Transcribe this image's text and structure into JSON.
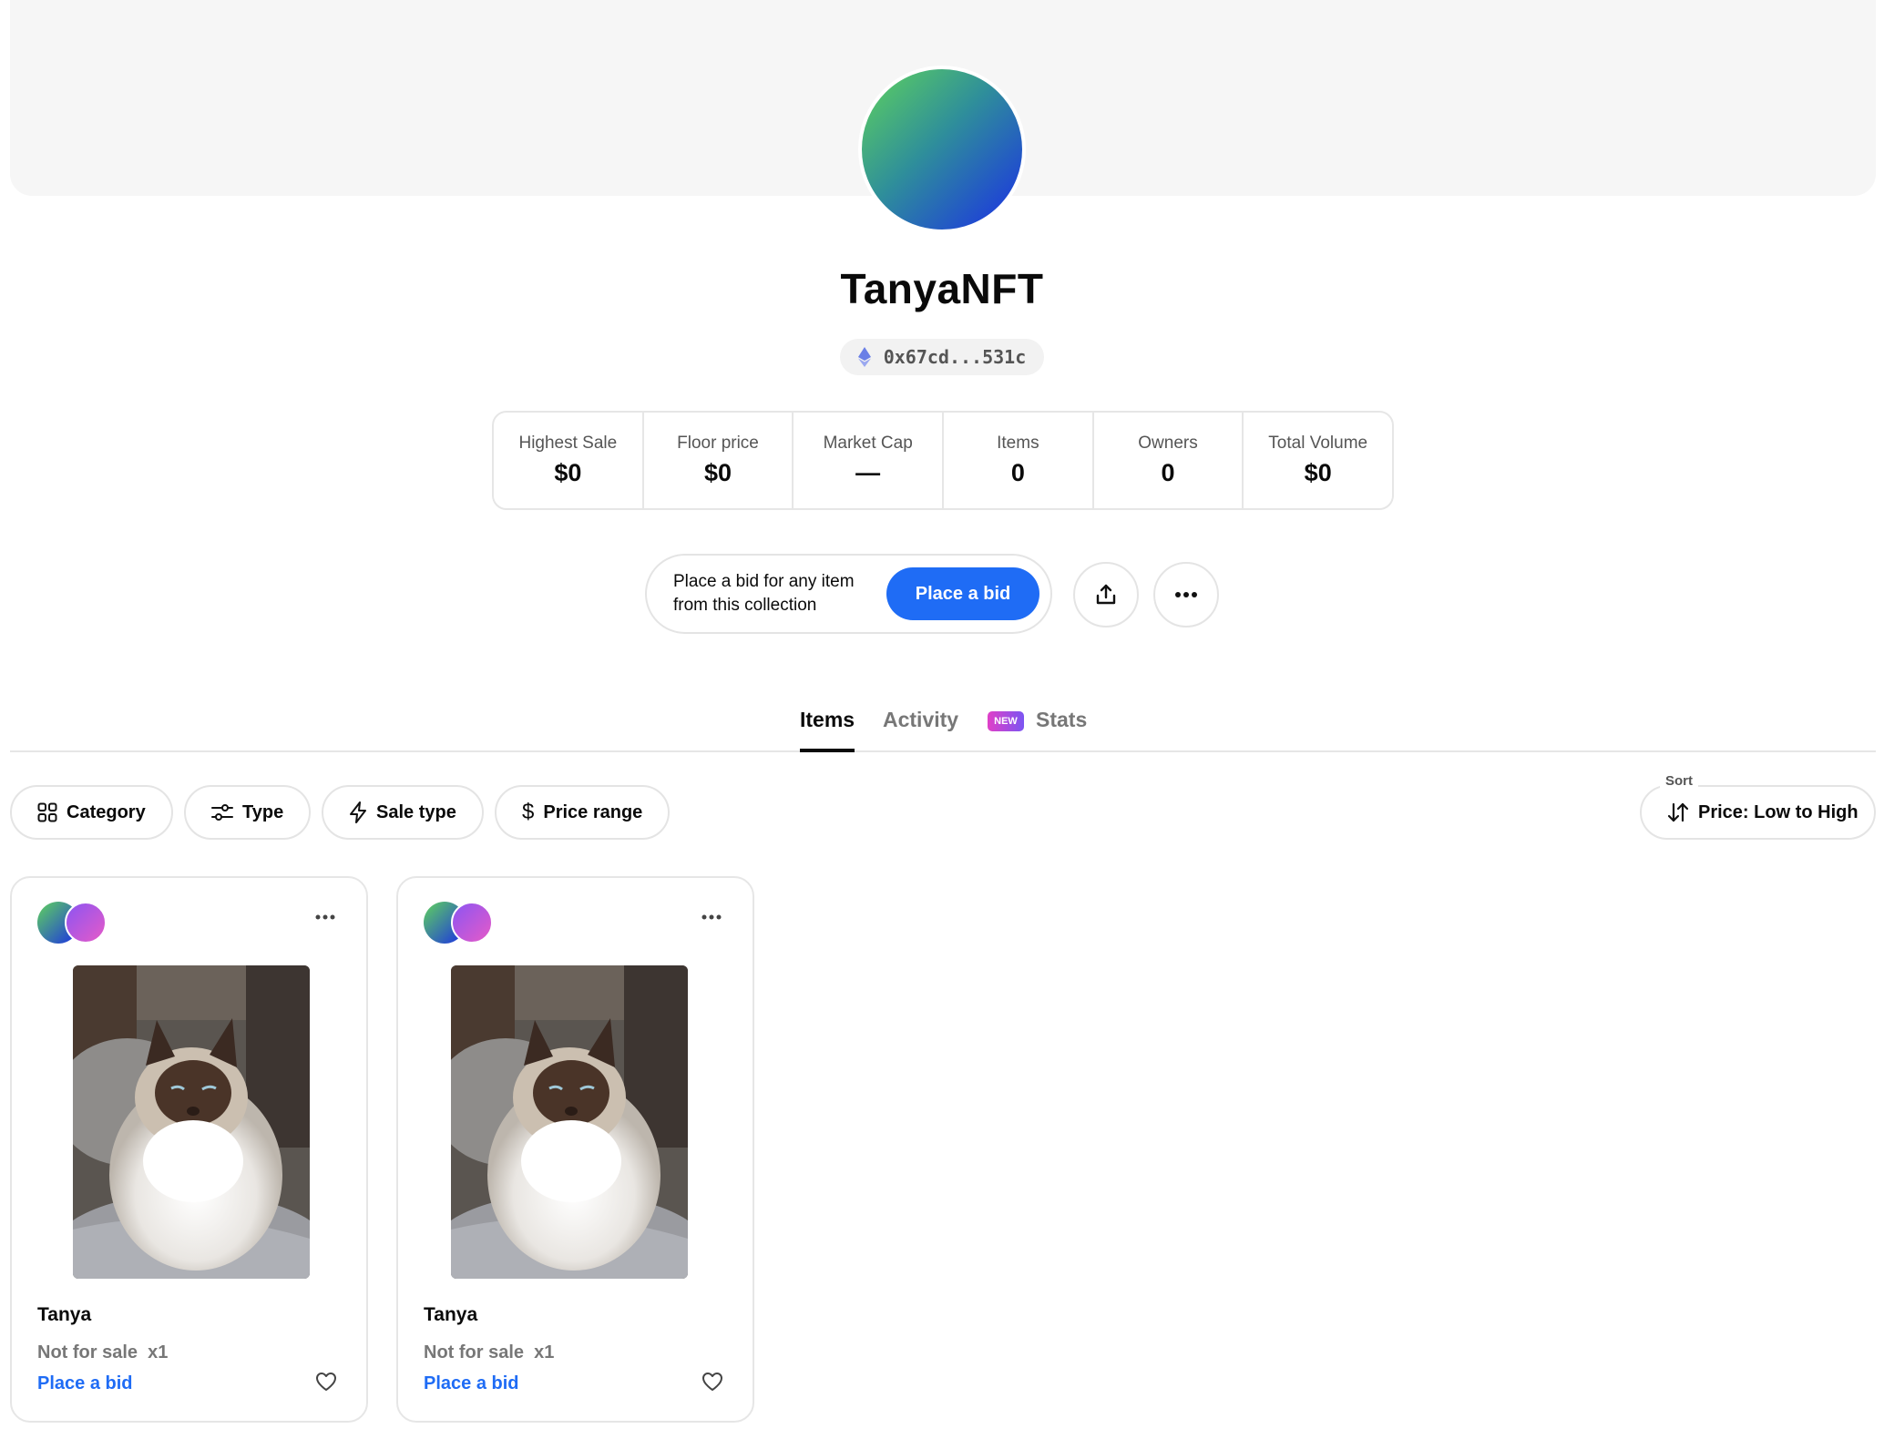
{
  "profile": {
    "name": "TanyaNFT",
    "address": "0x67cd...531c"
  },
  "stats": [
    {
      "label": "Highest Sale",
      "value": "$0"
    },
    {
      "label": "Floor price",
      "value": "$0"
    },
    {
      "label": "Market Cap",
      "value": "—"
    },
    {
      "label": "Items",
      "value": "0"
    },
    {
      "label": "Owners",
      "value": "0"
    },
    {
      "label": "Total Volume",
      "value": "$0"
    }
  ],
  "bid": {
    "text": "Place a bid for any item from this collection",
    "button": "Place a bid"
  },
  "tabs": {
    "items": "Items",
    "activity": "Activity",
    "new_badge": "NEW",
    "stats": "Stats"
  },
  "filters": {
    "category": "Category",
    "type": "Type",
    "sale_type": "Sale type",
    "price_range": "Price range"
  },
  "sort": {
    "label": "Sort",
    "value": "Price: Low to High"
  },
  "cards": [
    {
      "name": "Tanya",
      "status": "Not for sale",
      "quantity": "x1",
      "action": "Place a bid"
    },
    {
      "name": "Tanya",
      "status": "Not for sale",
      "quantity": "x1",
      "action": "Place a bid"
    }
  ],
  "colors": {
    "accent": "#1f6cf5",
    "badge_gradient_start": "#e040c8",
    "badge_gradient_end": "#7b55f2"
  }
}
